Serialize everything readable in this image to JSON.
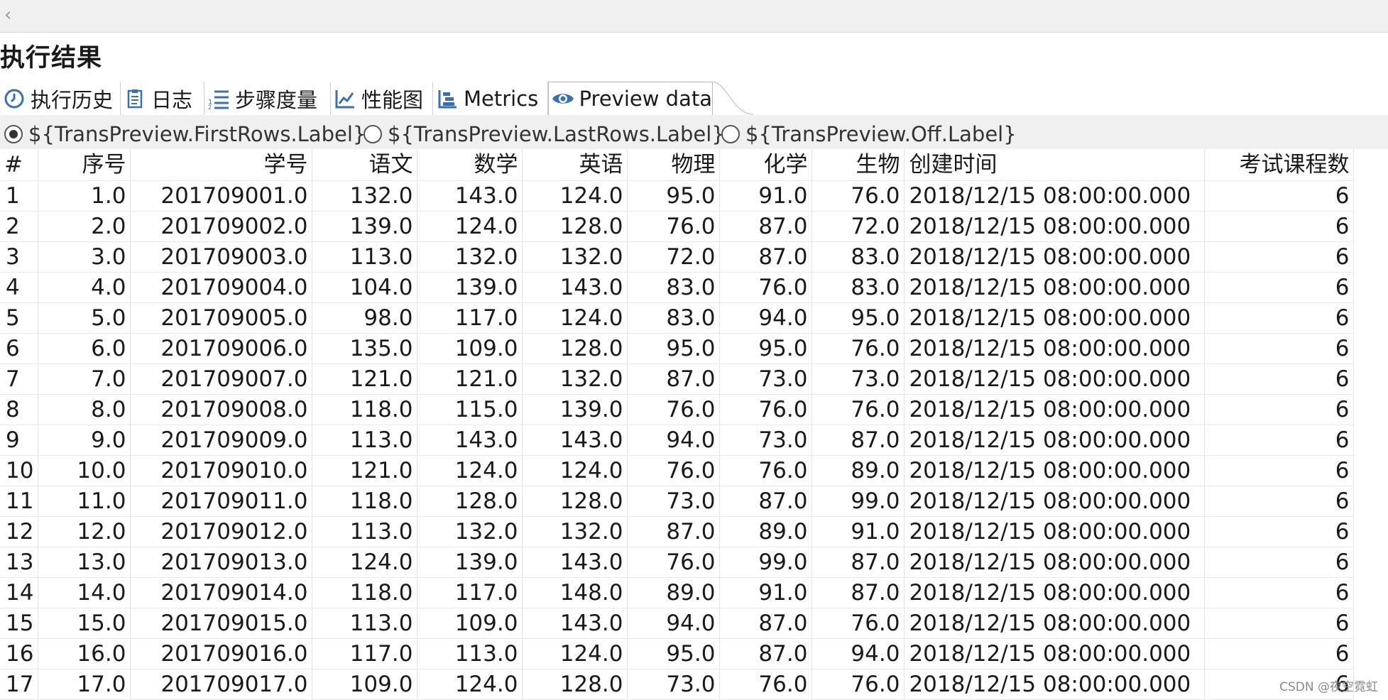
{
  "topbar": {
    "back_glyph": "‹"
  },
  "section_title": "执行结果",
  "tabs": [
    {
      "label": "执行历史",
      "icon": "clock-icon"
    },
    {
      "label": "日志",
      "icon": "clipboard-icon"
    },
    {
      "label": "步骤度量",
      "icon": "numbered-list-icon"
    },
    {
      "label": "性能图",
      "icon": "line-chart-icon"
    },
    {
      "label": "Metrics",
      "icon": "tree-structure-icon"
    },
    {
      "label": "Preview data",
      "icon": "eye-icon",
      "active": true
    }
  ],
  "options": [
    {
      "label": "${TransPreview.FirstRows.Label}",
      "checked": true
    },
    {
      "label": "${TransPreview.LastRows.Label}",
      "checked": false
    },
    {
      "label": "${TransPreview.Off.Label}",
      "checked": false
    }
  ],
  "table": {
    "columns": [
      "#",
      "序号",
      "学号",
      "语文",
      "数学",
      "英语",
      "物理",
      "化学",
      "生物",
      "创建时间",
      "考试课程数"
    ],
    "rows": [
      [
        "1",
        "1.0",
        "201709001.0",
        "132.0",
        "143.0",
        "124.0",
        "95.0",
        "91.0",
        "76.0",
        "2018/12/15 08:00:00.000",
        "6"
      ],
      [
        "2",
        "2.0",
        "201709002.0",
        "139.0",
        "124.0",
        "128.0",
        "76.0",
        "87.0",
        "72.0",
        "2018/12/15 08:00:00.000",
        "6"
      ],
      [
        "3",
        "3.0",
        "201709003.0",
        "113.0",
        "132.0",
        "132.0",
        "72.0",
        "87.0",
        "83.0",
        "2018/12/15 08:00:00.000",
        "6"
      ],
      [
        "4",
        "4.0",
        "201709004.0",
        "104.0",
        "139.0",
        "143.0",
        "83.0",
        "76.0",
        "83.0",
        "2018/12/15 08:00:00.000",
        "6"
      ],
      [
        "5",
        "5.0",
        "201709005.0",
        "98.0",
        "117.0",
        "124.0",
        "83.0",
        "94.0",
        "95.0",
        "2018/12/15 08:00:00.000",
        "6"
      ],
      [
        "6",
        "6.0",
        "201709006.0",
        "135.0",
        "109.0",
        "128.0",
        "95.0",
        "95.0",
        "76.0",
        "2018/12/15 08:00:00.000",
        "6"
      ],
      [
        "7",
        "7.0",
        "201709007.0",
        "121.0",
        "121.0",
        "132.0",
        "87.0",
        "73.0",
        "73.0",
        "2018/12/15 08:00:00.000",
        "6"
      ],
      [
        "8",
        "8.0",
        "201709008.0",
        "118.0",
        "115.0",
        "139.0",
        "76.0",
        "76.0",
        "76.0",
        "2018/12/15 08:00:00.000",
        "6"
      ],
      [
        "9",
        "9.0",
        "201709009.0",
        "113.0",
        "143.0",
        "143.0",
        "94.0",
        "73.0",
        "87.0",
        "2018/12/15 08:00:00.000",
        "6"
      ],
      [
        "10",
        "10.0",
        "201709010.0",
        "121.0",
        "124.0",
        "124.0",
        "76.0",
        "76.0",
        "89.0",
        "2018/12/15 08:00:00.000",
        "6"
      ],
      [
        "11",
        "11.0",
        "201709011.0",
        "118.0",
        "128.0",
        "128.0",
        "73.0",
        "87.0",
        "99.0",
        "2018/12/15 08:00:00.000",
        "6"
      ],
      [
        "12",
        "12.0",
        "201709012.0",
        "113.0",
        "132.0",
        "132.0",
        "87.0",
        "89.0",
        "91.0",
        "2018/12/15 08:00:00.000",
        "6"
      ],
      [
        "13",
        "13.0",
        "201709013.0",
        "124.0",
        "139.0",
        "143.0",
        "76.0",
        "99.0",
        "87.0",
        "2018/12/15 08:00:00.000",
        "6"
      ],
      [
        "14",
        "14.0",
        "201709014.0",
        "118.0",
        "117.0",
        "148.0",
        "89.0",
        "91.0",
        "87.0",
        "2018/12/15 08:00:00.000",
        "6"
      ],
      [
        "15",
        "15.0",
        "201709015.0",
        "113.0",
        "109.0",
        "143.0",
        "94.0",
        "87.0",
        "76.0",
        "2018/12/15 08:00:00.000",
        "6"
      ],
      [
        "16",
        "16.0",
        "201709016.0",
        "117.0",
        "113.0",
        "124.0",
        "95.0",
        "87.0",
        "94.0",
        "2018/12/15 08:00:00.000",
        "6"
      ],
      [
        "17",
        "17.0",
        "201709017.0",
        "109.0",
        "124.0",
        "128.0",
        "73.0",
        "76.0",
        "76.0",
        "2018/12/15 08:00:00.000",
        "6"
      ]
    ]
  },
  "watermark": "CSDN @夜空霓虹",
  "colors": {
    "accent": "#3c6fb0",
    "toolbar_bg": "#f0f0f0",
    "grid_line": "#e2e2e2"
  }
}
